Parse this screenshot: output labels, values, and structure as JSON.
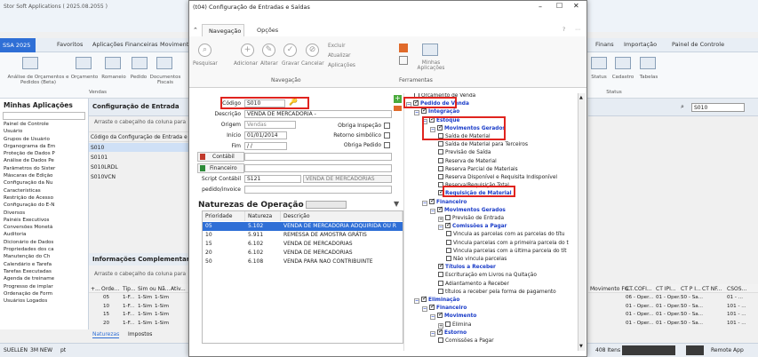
{
  "bg": {
    "title": "Stor Soft Applications ( 2025.08.2055 )",
    "company": "SSA 2025",
    "tabs": [
      "Favoritos",
      "Aplicações Financeiras",
      "Movimentos",
      "Finans",
      "Importação",
      "Painel de Controle"
    ],
    "ribbon_items": [
      "Análise de Orçamentos e Pedidos (Beta)",
      "Orçamento",
      "Romaneio",
      "Pedido",
      "Documentos Fiscais",
      "Status",
      "Cadastro",
      "Tabelas"
    ],
    "ribbon_group": "Vendas",
    "ribbon_group2": "Status",
    "left_title": "Minhas Aplicações",
    "tree": [
      "Painel de Controle",
      "Usuário",
      "Grupos de Usuário",
      "Organograma da Em",
      "Proteção de Dados P",
      "Análise de Dados Pe",
      "Parâmetros do Sister",
      "Máscaras de Edição",
      "Configuração da Nu",
      "Características",
      "Restrição de Acesso",
      "Configuração do E-N",
      "Diversos",
      "Painéis Executivos",
      "Conversões Monetá",
      "Auditoria",
      "Dicionário de Dados",
      "Propriedades dos ca",
      "Manutenção do Ch",
      "Calendário e Tarefa",
      "Tarefas Executadas",
      "Agenda de treiname",
      "Progresso de implar",
      "Ordenação de Form",
      "Usuários Logados"
    ],
    "main_title": "Configuração de Entrada",
    "drag_hint": "Arraste o cabeçalho da coluna para",
    "main_col": "Código da Configuração de Entrada e",
    "main_rows": [
      "S010",
      "S0101",
      "S010LRDL",
      "S010VCN"
    ],
    "search_value": "S010",
    "info_title": "Informações Complementares",
    "info_cols": [
      "+...",
      "Orde...",
      "Tip...",
      "Sim ou Nã...",
      "Ativ..."
    ],
    "info_rows": [
      [
        "05",
        "1-F...",
        "1-Sim",
        "1-Sim"
      ],
      [
        "10",
        "1-F...",
        "1-Sim",
        "1-Sim"
      ],
      [
        "15",
        "1-F...",
        "1-Sim",
        "1-Sim"
      ],
      [
        "20",
        "1-F...",
        "1-Sim",
        "1-Sim"
      ]
    ],
    "bottom_tabs": [
      "Naturezas",
      "Impostos"
    ],
    "right_cols": [
      "Movimento FG...",
      "CT COFI...",
      "CT IPI...",
      "CT P I...",
      "CT NF...",
      "CSOS..."
    ],
    "right_rows": [
      [
        "",
        "06 - Oper...",
        "01 - Oper...",
        "50 - Sa...",
        "01 - ..."
      ],
      [
        "",
        "01 - Oper...",
        "01 - Oper...",
        "50 - Sa...",
        "101 - ..."
      ],
      [
        "",
        "01 - Oper...",
        "01 - Oper...",
        "50 - Sa...",
        "101 - ..."
      ],
      [
        "",
        "01 - Oper...",
        "01 - Oper...",
        "50 - Sa...",
        "101 - ..."
      ]
    ],
    "status_user": "SUELLEN",
    "status_db": "3M NEW",
    "status_lang": "pt",
    "status_items": "408 Itens",
    "status_remote": "Remote App"
  },
  "modal": {
    "title": "(t04)  Configuração de Entradas e Saídas",
    "tabs": [
      "Navegação",
      "Opções"
    ],
    "ribbon": {
      "pesquisar": "Pesquisar",
      "adicionar": "Adicionar",
      "alterar": "Alterar",
      "gravar": "Gravar",
      "cancelar": "Cancelar",
      "excluir": "Excluir",
      "atualizar": "Atualizar",
      "aplicacoes": "Aplicações",
      "minhas_aplicacoes": "Minhas Aplicações",
      "group_nav": "Navegação",
      "group_tools": "Ferramentas"
    },
    "form": {
      "codigo_label": "Código",
      "codigo_value": "S010",
      "descricao_label": "Descrição",
      "descricao_value": "VENDA DE MERCADORIA -",
      "origem_label": "Origem",
      "origem_value": "Vendas",
      "inicio_label": "Início",
      "inicio_value": "01/01/2014",
      "fim_label": "Fim",
      "fim_value": "/ /",
      "contabil_label": "Contábil",
      "financeiro_label": "Financeiro",
      "script_label": "Script Contábil",
      "script_value": "S121",
      "script_desc": "VENDA DE MERCADORIAS",
      "pedido_label": "pedido/invoice",
      "obriga_inspecao": "Obriga Inspeção",
      "retorno_simbolico": "Retorno simbólico",
      "obriga_pedido": "Obriga Pedido"
    },
    "naturezas": {
      "title": "Naturezas de Operação",
      "cols": [
        "Prioridade",
        "Natureza",
        "Descrição"
      ],
      "rows": [
        [
          "05",
          "5.102",
          "VENDA DE MERCADORIA ADQUIRIDA OU R"
        ],
        [
          "10",
          "5.911",
          "REMESSA DE AMOSTRA GRÁTIS"
        ],
        [
          "15",
          "6.102",
          "VENDA DE MERCADORIAS"
        ],
        [
          "20",
          "6.102",
          "VENDA DE MERCADORIAS"
        ],
        [
          "50",
          "6.108",
          "VENDA PARA NAO CONTRIBUINTE"
        ]
      ]
    },
    "tree": [
      {
        "t": "Orçamento de Venda",
        "lvl": 1,
        "cb": false
      },
      {
        "t": "Pedido de Venda",
        "lvl": 0,
        "cb": true,
        "blue": true,
        "ex": "−"
      },
      {
        "t": "Integração",
        "lvl": 1,
        "cb": true,
        "blue": true,
        "ex": "−"
      },
      {
        "t": "Estoque",
        "lvl": 2,
        "cb": true,
        "blue": true,
        "ex": "−"
      },
      {
        "t": "Movimentos Gerados",
        "lvl": 3,
        "cb": true,
        "blue": true,
        "ex": "−"
      },
      {
        "t": "Saída de Material",
        "lvl": 4,
        "cb": false
      },
      {
        "t": "Saída de Material para Terceiros",
        "lvl": 4,
        "cb": false
      },
      {
        "t": "Previsão de Saída",
        "lvl": 4,
        "cb": false
      },
      {
        "t": "Reserva de Material",
        "lvl": 4,
        "cb": false
      },
      {
        "t": "Reserva Parcial de Materiais",
        "lvl": 4,
        "cb": false
      },
      {
        "t": "Reserva Disponível e Requisita Indisponível",
        "lvl": 4,
        "cb": false
      },
      {
        "t": "Reserva/Requisição Total",
        "lvl": 4,
        "cb": false
      },
      {
        "t": "Requisição de Material",
        "lvl": 4,
        "cb": true,
        "blue": true
      },
      {
        "t": "Financeiro",
        "lvl": 2,
        "cb": true,
        "blue": true,
        "ex": "−"
      },
      {
        "t": "Movimentos Gerados",
        "lvl": 3,
        "cb": true,
        "blue": true,
        "ex": "−"
      },
      {
        "t": "Previsão de Entrada",
        "lvl": 4,
        "cb": false,
        "ex": "+"
      },
      {
        "t": "Comissões a Pagar",
        "lvl": 4,
        "cb": true,
        "blue": true,
        "ex": "−"
      },
      {
        "t": "Vincula as parcelas com as parcelas do títu",
        "lvl": 5,
        "cb": false
      },
      {
        "t": "Vincula parcelas com a primeira parcela do t",
        "lvl": 5,
        "cb": false
      },
      {
        "t": "Vincula parcelas com a última parcela do tít",
        "lvl": 5,
        "cb": false
      },
      {
        "t": "Não vincula parcelas",
        "lvl": 5,
        "cb": false
      },
      {
        "t": "Títulos a Receber",
        "lvl": 4,
        "cb": true,
        "blue": true
      },
      {
        "t": "Escrituração em Livros na Quitação",
        "lvl": 4,
        "cb": false
      },
      {
        "t": "Adiantamento a Receber",
        "lvl": 4,
        "cb": false
      },
      {
        "t": "títulos a receber pela forma de pagamento",
        "lvl": 4,
        "cb": false
      },
      {
        "t": "Eliminação",
        "lvl": 1,
        "cb": true,
        "blue": true,
        "ex": "−"
      },
      {
        "t": "Financeiro",
        "lvl": 2,
        "cb": true,
        "blue": true,
        "ex": "−"
      },
      {
        "t": "Movimento",
        "lvl": 3,
        "cb": true,
        "blue": true,
        "ex": "−"
      },
      {
        "t": "Elimina",
        "lvl": 4,
        "cb": false,
        "ex": "+"
      },
      {
        "t": "Estorno",
        "lvl": 3,
        "cb": true,
        "blue": true,
        "ex": "−"
      },
      {
        "t": "Comissões a Pagar",
        "lvl": 4,
        "cb": false
      }
    ],
    "colors": {
      "accent": "#2f6fd6",
      "highlight": "#e0241f",
      "tree_blue": "#1a3cc8"
    }
  }
}
